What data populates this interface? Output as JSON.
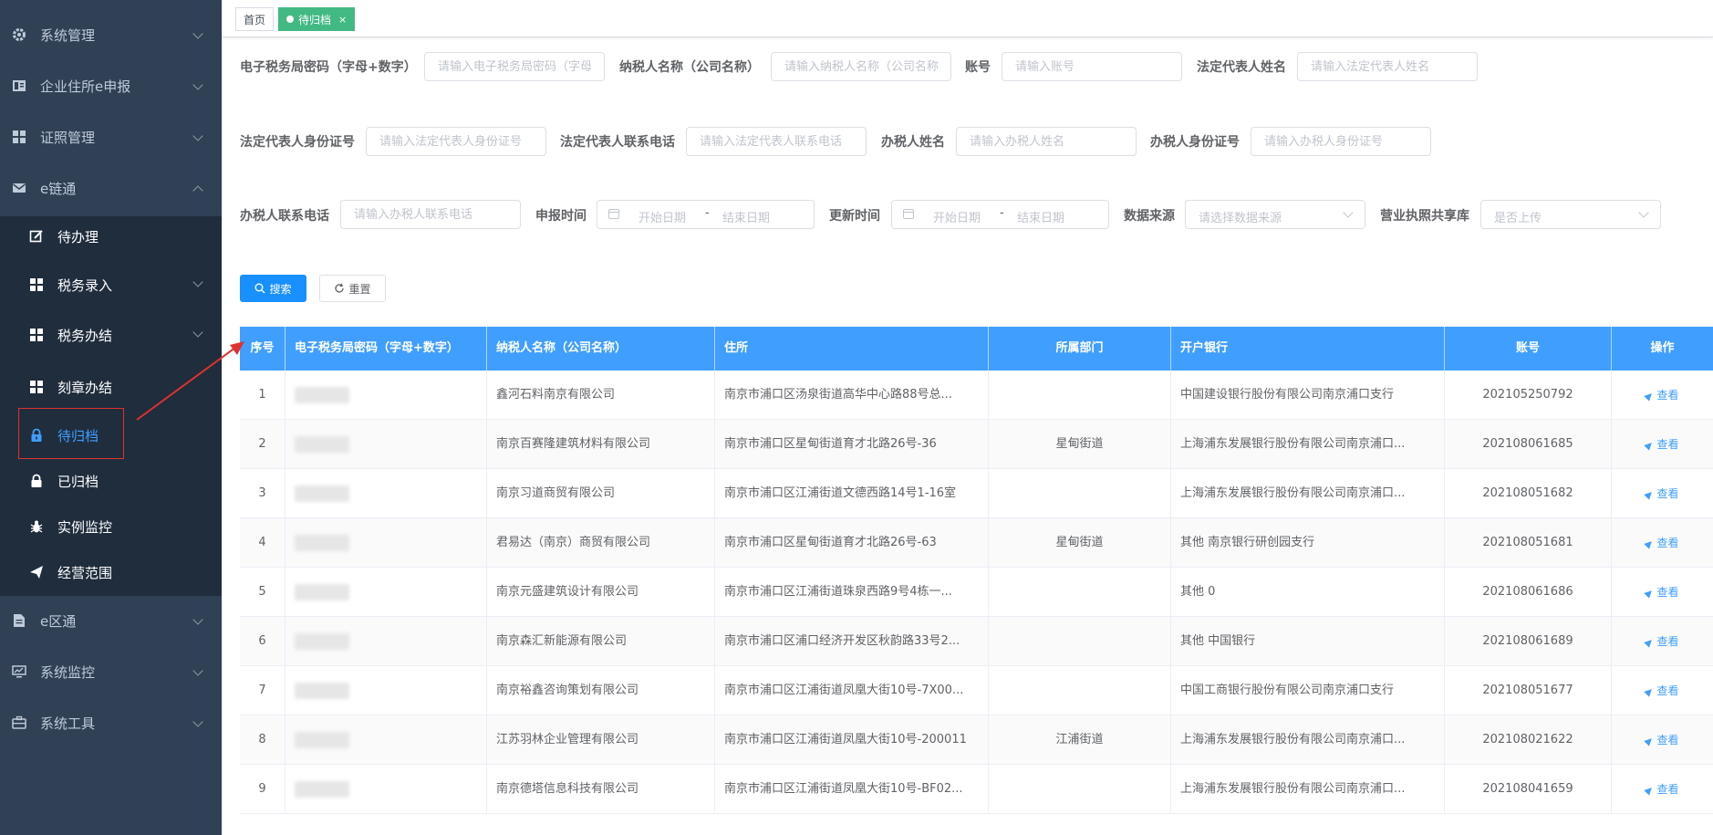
{
  "sidebar": {
    "items": [
      {
        "label": "系统管理",
        "icon": "gear-icon"
      },
      {
        "label": "企业住所e申报",
        "icon": "card-icon"
      },
      {
        "label": "证照管理",
        "icon": "grid-icon"
      },
      {
        "label": "e链通",
        "icon": "mail-icon"
      },
      {
        "label": "e区通",
        "icon": "document-icon"
      },
      {
        "label": "系统监控",
        "icon": "monitor-icon"
      },
      {
        "label": "系统工具",
        "icon": "toolbox-icon"
      }
    ],
    "sub_items": [
      {
        "label": "待办理",
        "icon": "edit-icon"
      },
      {
        "label": "税务录入",
        "icon": "grid-icon"
      },
      {
        "label": "税务办结",
        "icon": "grid-icon"
      },
      {
        "label": "刻章办结",
        "icon": "grid-icon"
      },
      {
        "label": "待归档",
        "icon": "lock-icon"
      },
      {
        "label": "已归档",
        "icon": "lock-icon"
      },
      {
        "label": "实例监控",
        "icon": "bug-icon"
      },
      {
        "label": "经营范围",
        "icon": "send-icon"
      }
    ],
    "active_sub": "待归档"
  },
  "tabs": [
    {
      "label": "首页"
    },
    {
      "label": "待归档",
      "active": true,
      "close": "×"
    }
  ],
  "filters": {
    "tax_password_label": "电子税务局密码（字母+数字）",
    "tax_password_ph": "请输入电子税务局密码（字母+数字）",
    "taxpayer_name_label": "纳税人名称（公司名称）",
    "taxpayer_name_ph": "请输入纳税人名称（公司名称）",
    "account_label": "账号",
    "account_ph": "请输入账号",
    "legal_name_label": "法定代表人姓名",
    "legal_name_ph": "请输入法定代表人姓名",
    "legal_id_label": "法定代表人身份证号",
    "legal_id_ph": "请输入法定代表人身份证号",
    "legal_phone_label": "法定代表人联系电话",
    "legal_phone_ph": "请输入法定代表人联系电话",
    "agent_name_label": "办税人姓名",
    "agent_name_ph": "请输入办税人姓名",
    "agent_id_label": "办税人身份证号",
    "agent_id_ph": "请输入办税人身份证号",
    "agent_phone_label": "办税人联系电话",
    "agent_phone_ph": "请输入办税人联系电话",
    "report_time_label": "申报时间",
    "update_time_label": "更新时间",
    "start_date_ph": "开始日期",
    "end_date_ph": "结束日期",
    "range_sep": "-",
    "data_source_label": "数据来源",
    "data_source_ph": "请选择数据来源",
    "license_label": "营业执照共享库",
    "license_ph": "是否上传"
  },
  "buttons": {
    "search": "搜索",
    "reset": "重置"
  },
  "table": {
    "columns": [
      "序号",
      "电子税务局密码（字母+数字）",
      "纳税人名称（公司名称）",
      "住所",
      "所属部门",
      "开户银行",
      "账号",
      "操作"
    ],
    "view_label": "查看",
    "rows": [
      {
        "no": "1",
        "name": "鑫河石料南京有限公司",
        "address": "南京市浦口区汤泉街道高华中心路88号总...",
        "dept": "",
        "bank": "中国建设银行股份有限公司南京浦口支行",
        "account": "202105250792"
      },
      {
        "no": "2",
        "name": "南京百赛隆建筑材料有限公司",
        "address": "南京市浦口区星甸街道育才北路26号-36",
        "dept": "星甸街道",
        "bank": "上海浦东发展银行股份有限公司南京浦口...",
        "account": "202108061685"
      },
      {
        "no": "3",
        "name": "南京习道商贸有限公司",
        "address": "南京市浦口区江浦街道文德西路14号1-16室",
        "dept": "",
        "bank": "上海浦东发展银行股份有限公司南京浦口...",
        "account": "202108051682"
      },
      {
        "no": "4",
        "name": "君易达（南京）商贸有限公司",
        "address": "南京市浦口区星甸街道育才北路26号-63",
        "dept": "星甸街道",
        "bank": "其他  南京银行研创园支行",
        "account": "202108051681"
      },
      {
        "no": "5",
        "name": "南京元盛建筑设计有限公司",
        "address": "南京市浦口区江浦街道珠泉西路9号4栋一...",
        "dept": "",
        "bank": "其他  0",
        "account": "202108061686"
      },
      {
        "no": "6",
        "name": "南京森汇新能源有限公司",
        "address": "南京市浦口区浦口经济开发区秋韵路33号2...",
        "dept": "",
        "bank": "其他  中国银行",
        "account": "202108061689"
      },
      {
        "no": "7",
        "name": "南京裕鑫咨询策划有限公司",
        "address": "南京市浦口区江浦街道凤凰大街10号-7X00...",
        "dept": "",
        "bank": "中国工商银行股份有限公司南京浦口支行",
        "account": "202108051677"
      },
      {
        "no": "8",
        "name": "江苏羽林企业管理有限公司",
        "address": "南京市浦口区江浦街道凤凰大街10号-200011",
        "dept": "江浦街道",
        "bank": "上海浦东发展银行股份有限公司南京浦口...",
        "account": "202108021622"
      },
      {
        "no": "9",
        "name": "南京德塔信息科技有限公司",
        "address": "南京市浦口区江浦街道凤凰大街10号-BF02...",
        "dept": "",
        "bank": "上海浦东发展银行股份有限公司南京浦口...",
        "account": "202108041659"
      }
    ]
  },
  "colors": {
    "sidebar_bg": "#304156",
    "submenu_bg": "#1f2d3d",
    "accent": "#409eff",
    "tab_active": "#42b983",
    "annotation": "#e0312f"
  }
}
